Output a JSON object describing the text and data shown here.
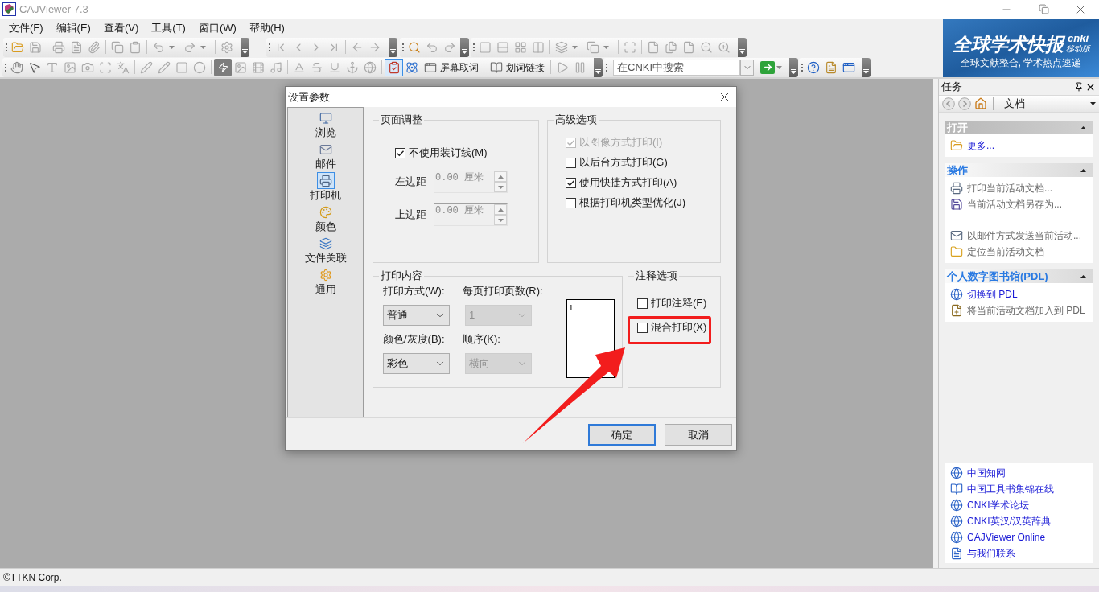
{
  "window": {
    "title": "CAJViewer 7.3"
  },
  "menu": [
    "文件(F)",
    "编辑(E)",
    "查看(V)",
    "工具(T)",
    "窗口(W)",
    "帮助(H)"
  ],
  "toolbar": {
    "clip_tool": {
      "pressed": true
    },
    "text_buttons": [
      {
        "label": "屏幕取词",
        "pressed": false
      },
      {
        "label": "划词链接",
        "pressed": false
      }
    ],
    "search": {
      "placeholder": "在CNKI中搜索"
    }
  },
  "banner": {
    "title": "全球学术快报",
    "brand": "cnki",
    "edition": "移动版",
    "subtitle": "全球文献整合, 学术热点速递"
  },
  "dialog": {
    "title": "设置参数",
    "nav": [
      {
        "label": "浏览",
        "selected": false
      },
      {
        "label": "邮件",
        "selected": false
      },
      {
        "label": "打印机",
        "selected": true
      },
      {
        "label": "颜色",
        "selected": false
      },
      {
        "label": "文件关联",
        "selected": false
      },
      {
        "label": "通用",
        "selected": false
      }
    ],
    "page_adjust": {
      "title": "页面调整",
      "binding": {
        "label": "不使用装订线(M)",
        "checked": true
      },
      "margins": [
        {
          "label": "左边距",
          "value": "0.00 厘米",
          "disabled": true
        },
        {
          "label": "上边距",
          "value": "0.00 厘米",
          "disabled": true
        }
      ]
    },
    "advanced": {
      "title": "高级选项",
      "options": [
        {
          "label": "以图像方式打印(I)",
          "checked": true,
          "disabled": true
        },
        {
          "label": "以后台方式打印(G)",
          "checked": false,
          "disabled": false
        },
        {
          "label": "使用快捷方式打印(A)",
          "checked": true,
          "disabled": false
        },
        {
          "label": "根据打印机类型优化(J)",
          "checked": false,
          "disabled": false
        }
      ]
    },
    "print_content": {
      "title": "打印内容",
      "selects": [
        {
          "label": "打印方式(W):",
          "value": "普通",
          "disabled": false
        },
        {
          "label": "每页打印页数(R):",
          "value": "1",
          "disabled": true
        },
        {
          "label": "颜色/灰度(B):",
          "value": "彩色",
          "disabled": false
        },
        {
          "label": "顺序(K):",
          "value": "横向",
          "disabled": true
        }
      ],
      "preview": {
        "page_number": "1"
      }
    },
    "annotation": {
      "title": "注释选项",
      "options": [
        {
          "label": "打印注释(E)",
          "checked": false
        },
        {
          "label": "混合打印(X)",
          "checked": false
        }
      ]
    },
    "buttons": [
      {
        "label": "确定",
        "default": true
      },
      {
        "label": "取消",
        "default": false
      }
    ]
  },
  "task_pane": {
    "title": "任务",
    "location": "文档",
    "sections": [
      {
        "title": "打开",
        "highlighted": true,
        "expanded": true,
        "items": [
          {
            "kind": "link",
            "label": "更多...",
            "disabled": false
          }
        ]
      },
      {
        "title": "操作",
        "highlighted": false,
        "expanded": true,
        "items": [
          {
            "kind": "link",
            "label": "打印当前活动文档...",
            "disabled": true
          },
          {
            "kind": "link",
            "label": "当前活动文档另存为...",
            "disabled": true
          },
          {
            "kind": "divider"
          },
          {
            "kind": "link",
            "label": "以邮件方式发送当前活动...",
            "disabled": true
          },
          {
            "kind": "link",
            "label": "定位当前活动文档",
            "disabled": true
          }
        ]
      },
      {
        "title": "个人数字图书馆(PDL)",
        "highlighted": false,
        "expanded": true,
        "items": [
          {
            "kind": "link",
            "label": "切换到 PDL",
            "disabled": false
          },
          {
            "kind": "link",
            "label": "将当前活动文档加入到 PDL",
            "disabled": true
          }
        ]
      }
    ],
    "links": [
      "中国知网",
      "中国工具书集锦在线",
      "CNKI学术论坛",
      "CNKI英汉/汉英辞典",
      "CAJViewer Online",
      "与我们联系"
    ]
  },
  "status_bar": {
    "text": "©TTKN Corp."
  }
}
